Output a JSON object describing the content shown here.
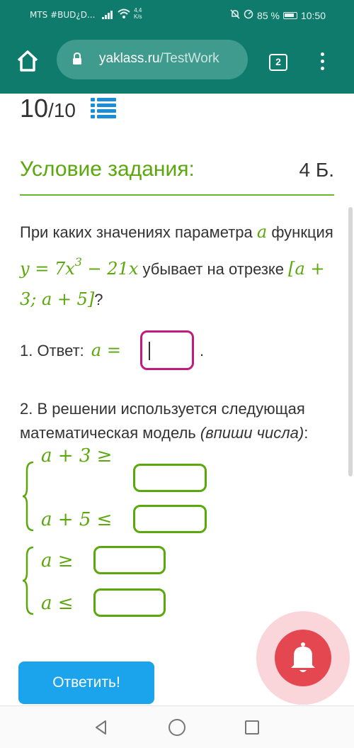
{
  "status_bar": {
    "carrier": "MTS #BUD¿D...",
    "speed_value": "4,4",
    "speed_unit": "K/s",
    "battery": "85 %",
    "time": "10:50",
    "icons": [
      "signal-icon",
      "wifi-icon",
      "mute-icon",
      "alarm-icon",
      "battery-icon"
    ]
  },
  "browser": {
    "url_domain": "yaklass.ru",
    "url_path": "/TestWork",
    "tab_count": "2",
    "icons": [
      "home-icon",
      "lock-icon",
      "tabs-icon",
      "menu-icon"
    ]
  },
  "score": {
    "current": "10",
    "total": "/10"
  },
  "task": {
    "condition_title": "Условие задания:",
    "points": "4 Б.",
    "question_part1": "При каких значениях параметра",
    "param": "a",
    "question_part2": "функция",
    "function_lhs": "y = 7x",
    "function_exp": "3",
    "function_rhs": " − 21x",
    "question_part3": "убывает на отрезке",
    "interval": "[a + 3; a + 5]",
    "question_end": "?",
    "answer1_label": "1. Ответ:",
    "answer1_math": "a =",
    "answer1_value": "",
    "answer1_end": ".",
    "question2_main": "2. В решении используется следующая математическая модель ",
    "question2_hint": "(впиши числа)",
    "question2_end": ":",
    "system1": {
      "row1": "a + 3 ≥",
      "row2": "a + 5 ≤"
    },
    "system2": {
      "row1": "a ≥",
      "row2": "a ≤"
    },
    "submit_label": "Ответить!"
  },
  "colors": {
    "brand_teal": "#0f7b6c",
    "accent_green": "#5aa80c",
    "focus_magenta": "#c21b7d",
    "button_blue": "#1ba3ec",
    "bell_red": "#e4474f"
  },
  "nav_bar": {
    "icons": [
      "back-icon",
      "home-circle-icon",
      "recent-apps-icon"
    ]
  }
}
